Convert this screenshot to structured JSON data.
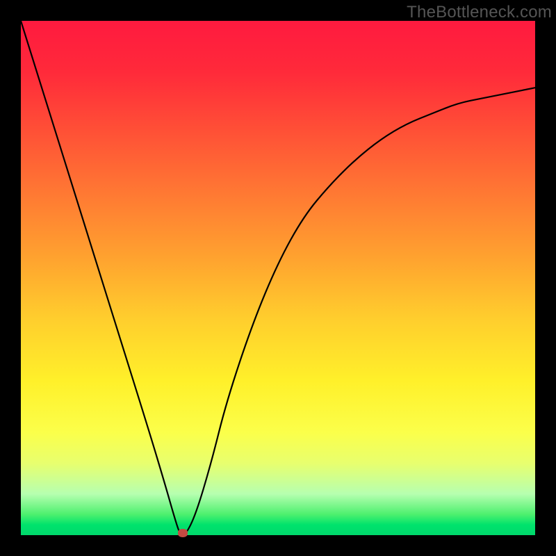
{
  "watermark": "TheBottleneck.com",
  "chart_data": {
    "type": "line",
    "title": "",
    "xlabel": "",
    "ylabel": "",
    "xlim": [
      0,
      1
    ],
    "ylim": [
      0,
      1
    ],
    "grid": false,
    "legend": false,
    "axes_visible": false,
    "series": [
      {
        "name": "bottleneck-curve",
        "x": [
          0.0,
          0.05,
          0.1,
          0.15,
          0.2,
          0.25,
          0.28,
          0.3,
          0.31,
          0.32,
          0.34,
          0.37,
          0.4,
          0.45,
          0.5,
          0.55,
          0.6,
          0.65,
          0.7,
          0.75,
          0.8,
          0.85,
          0.9,
          0.95,
          1.0
        ],
        "y": [
          1.0,
          0.84,
          0.68,
          0.52,
          0.36,
          0.2,
          0.1,
          0.03,
          0.0,
          0.0,
          0.04,
          0.14,
          0.26,
          0.41,
          0.53,
          0.62,
          0.68,
          0.73,
          0.77,
          0.8,
          0.82,
          0.84,
          0.85,
          0.86,
          0.87
        ]
      }
    ],
    "min_marker": {
      "x": 0.315,
      "y": 0.0
    },
    "bands": [
      {
        "label": "bad-top",
        "color": "#ff1a3f",
        "from": 0.0,
        "to": 0.15
      },
      {
        "label": "orange",
        "color": "#ffa22f",
        "from": 0.15,
        "to": 0.7
      },
      {
        "label": "yellow",
        "color": "#fff02a",
        "from": 0.7,
        "to": 0.9
      },
      {
        "label": "light-band",
        "color": "#e8ff6e",
        "from": 0.9,
        "to": 0.96
      },
      {
        "label": "good-bottom",
        "color": "#00d86c",
        "from": 0.96,
        "to": 1.0
      }
    ]
  }
}
